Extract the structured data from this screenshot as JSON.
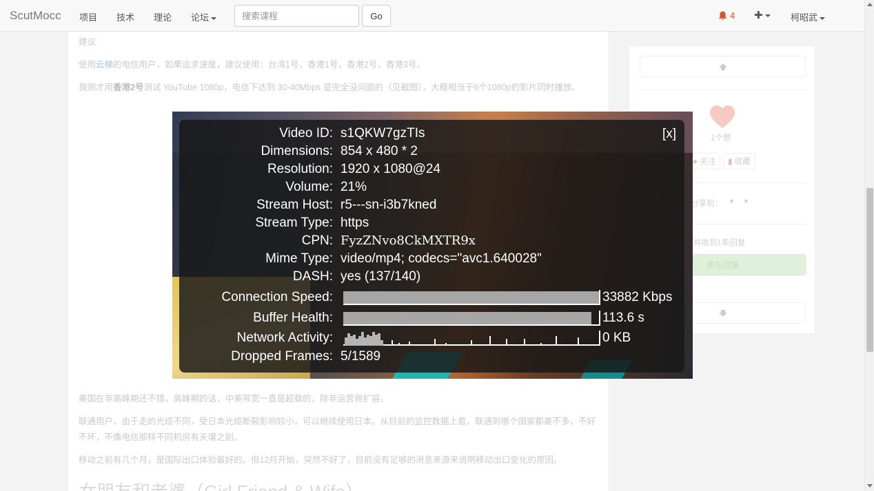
{
  "navbar": {
    "brand": "ScutMocc",
    "links": [
      "项目",
      "技术",
      "理论"
    ],
    "forum": "论坛",
    "search_placeholder": "搜索课程",
    "go": "Go",
    "notification_count": "4",
    "plus": "✚",
    "user": "柯昭武"
  },
  "article": {
    "p1": "建议",
    "p2_prefix": "使用",
    "p2_link": "云梯",
    "p2_suffix": "的电信用户，如果追求速度，建议使用：台湾1号，香港1号，香港2号，香港3号。",
    "p3_prefix": "我刚才用",
    "p3_bold": "香港2号",
    "p3_suffix": "测试 YouTube 1080p，电信下达到 30-40Mbps 是完全没问题的（见截图），大概相当于6个1080p的影片同时播放。",
    "p4": "美国在非高峰期还不错，高峰期的话，中美带宽一直是超载的，除非运营商扩容。",
    "p5": "联通用户，由于走的光缆不同，受日本光缆断裂影响较小，可以继续使用日本。从目前的监控数据上看，联通到哪个国家都差不多，不好不坏，不像电信那样不同机房有天壤之别。",
    "p6": "移动之前有几个月，是国际出口体验最好的。但12月开始，突然不好了，目前没有足够的消息来源来说明移动出口变化的原因。",
    "heading": "女朋友和老婆（Girl Friend & Wife）"
  },
  "sidebar": {
    "likes": "1个赞",
    "follow": "关注",
    "favorite": "收藏",
    "share": "分享到：",
    "replies": "共收到1条回复",
    "reply_button": "参与回复"
  },
  "stats_overlay": {
    "close": "[x]",
    "rows": [
      {
        "label": "Video ID:",
        "value": "s1QKW7gzTIs"
      },
      {
        "label": "Dimensions:",
        "value": "854 x 480 * 2"
      },
      {
        "label": "Resolution:",
        "value": "1920 x 1080@24"
      },
      {
        "label": "Volume:",
        "value": "21%"
      },
      {
        "label": "Stream Host:",
        "value": "r5---sn-i3b7kned"
      },
      {
        "label": "Stream Type:",
        "value": "https"
      },
      {
        "label": "CPN:",
        "value": "FyzZNvo8CkMXTR9x"
      },
      {
        "label": "Mime Type:",
        "value": "video/mp4; codecs=\"avc1.640028\""
      },
      {
        "label": "DASH:",
        "value": "yes (137/140)"
      }
    ],
    "connection_speed": {
      "label": "Connection Speed:",
      "value": "33882 Kbps",
      "fill": 1.0
    },
    "buffer_health": {
      "label": "Buffer Health:",
      "value": "113.6 s",
      "fill": 0.97
    },
    "network_activity": {
      "label": "Network Activity:",
      "value": "0 KB"
    },
    "dropped_frames": {
      "label": "Dropped Frames:",
      "value": "5/1589"
    }
  }
}
